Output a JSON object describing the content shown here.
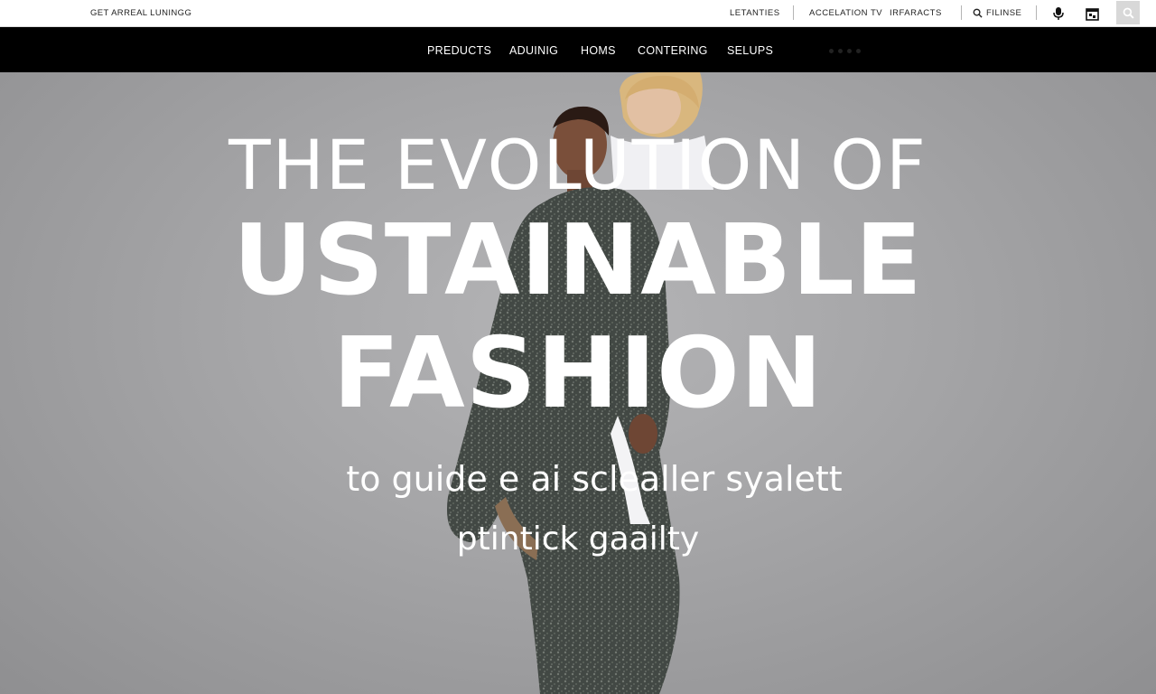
{
  "utility_bar": {
    "promo": "GET ARREAL LUNINGG",
    "links": [
      "LETANTIES",
      "ACCELATION",
      "TV",
      "IRFARACTS",
      "FILINSE"
    ],
    "icons": [
      "search-icon",
      "microphone-icon",
      "calendar-icon",
      "search-icon"
    ]
  },
  "nav": {
    "items": [
      "PREDUCTS",
      "ADUINIG",
      "HOMS",
      "CONTERING",
      "SELUPS"
    ]
  },
  "hero": {
    "line1": "THE EVOLUTION OF",
    "line2": "USTAINABLE",
    "line3": "FASHION",
    "sub1": "to guide e ai sclealler syalett",
    "sub2": "ptintick gaailty"
  },
  "colors": {
    "nav_bg": "#000000",
    "utility_bg": "#ffffff",
    "hero_bg": "#a8a8aa",
    "headline": "#ffffff"
  }
}
